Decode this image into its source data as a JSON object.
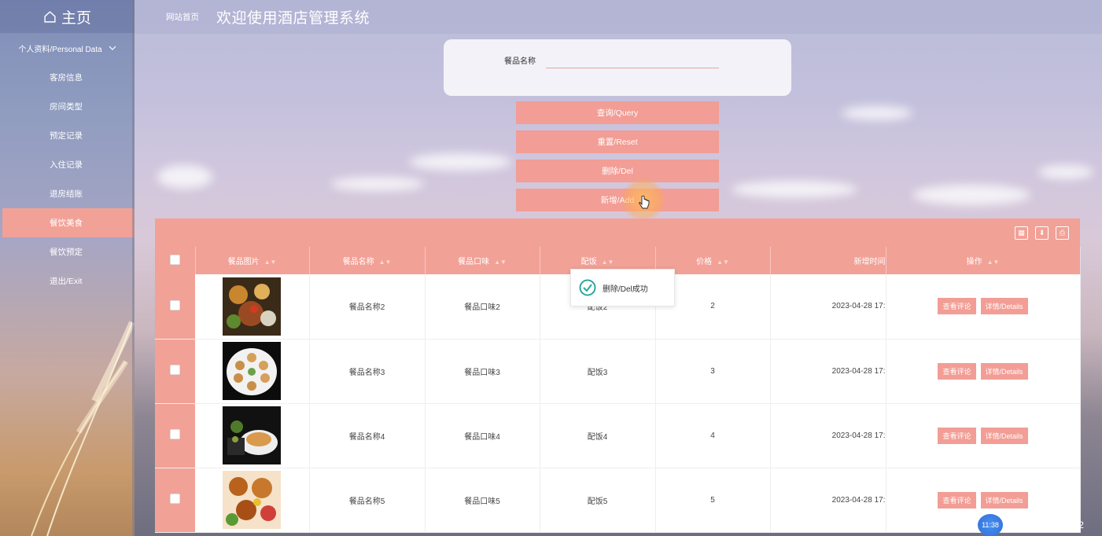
{
  "sidebar": {
    "home_label": "主页",
    "group_label": "个人资料/Personal Data",
    "items": [
      {
        "label": "客房信息"
      },
      {
        "label": "房间类型"
      },
      {
        "label": "预定记录"
      },
      {
        "label": "入住记录"
      },
      {
        "label": "退房结账"
      },
      {
        "label": "餐饮美食"
      },
      {
        "label": "餐饮预定"
      },
      {
        "label": "退出/Exit"
      }
    ],
    "active_index": 5
  },
  "header": {
    "breadcrumb": "网站首页",
    "title": "欢迎使用酒店管理系统"
  },
  "search": {
    "label": "餐品名称",
    "value": ""
  },
  "actions": {
    "query": "查询/Query",
    "reset": "重置/Reset",
    "delete": "删除/Del",
    "add": "新增/Add"
  },
  "table": {
    "columns": [
      "餐品图片",
      "餐品名称",
      "餐品口味",
      "配饭",
      "价格",
      "新增时间",
      "操作"
    ],
    "rows": [
      {
        "name": "餐品名称2",
        "taste": "餐品口味2",
        "rice": "配饭2",
        "price": "2",
        "time": "2023-04-28 17:"
      },
      {
        "name": "餐品名称3",
        "taste": "餐品口味3",
        "rice": "配饭3",
        "price": "3",
        "time": "2023-04-28 17:"
      },
      {
        "name": "餐品名称4",
        "taste": "餐品口味4",
        "rice": "配饭4",
        "price": "4",
        "time": "2023-04-28 17:"
      },
      {
        "name": "餐品名称5",
        "taste": "餐品口味5",
        "rice": "配饭5",
        "price": "5",
        "time": "2023-04-28 17:"
      }
    ],
    "row_actions": {
      "comments": "查看评论",
      "details": "详情/Details"
    }
  },
  "toast": {
    "message": "删除/Del成功"
  },
  "watermark": {
    "clock": "11:38",
    "text": "CSDN @vxbishe2"
  },
  "colors": {
    "accent": "#f2a197",
    "toast_check": "#2aa8a0"
  }
}
